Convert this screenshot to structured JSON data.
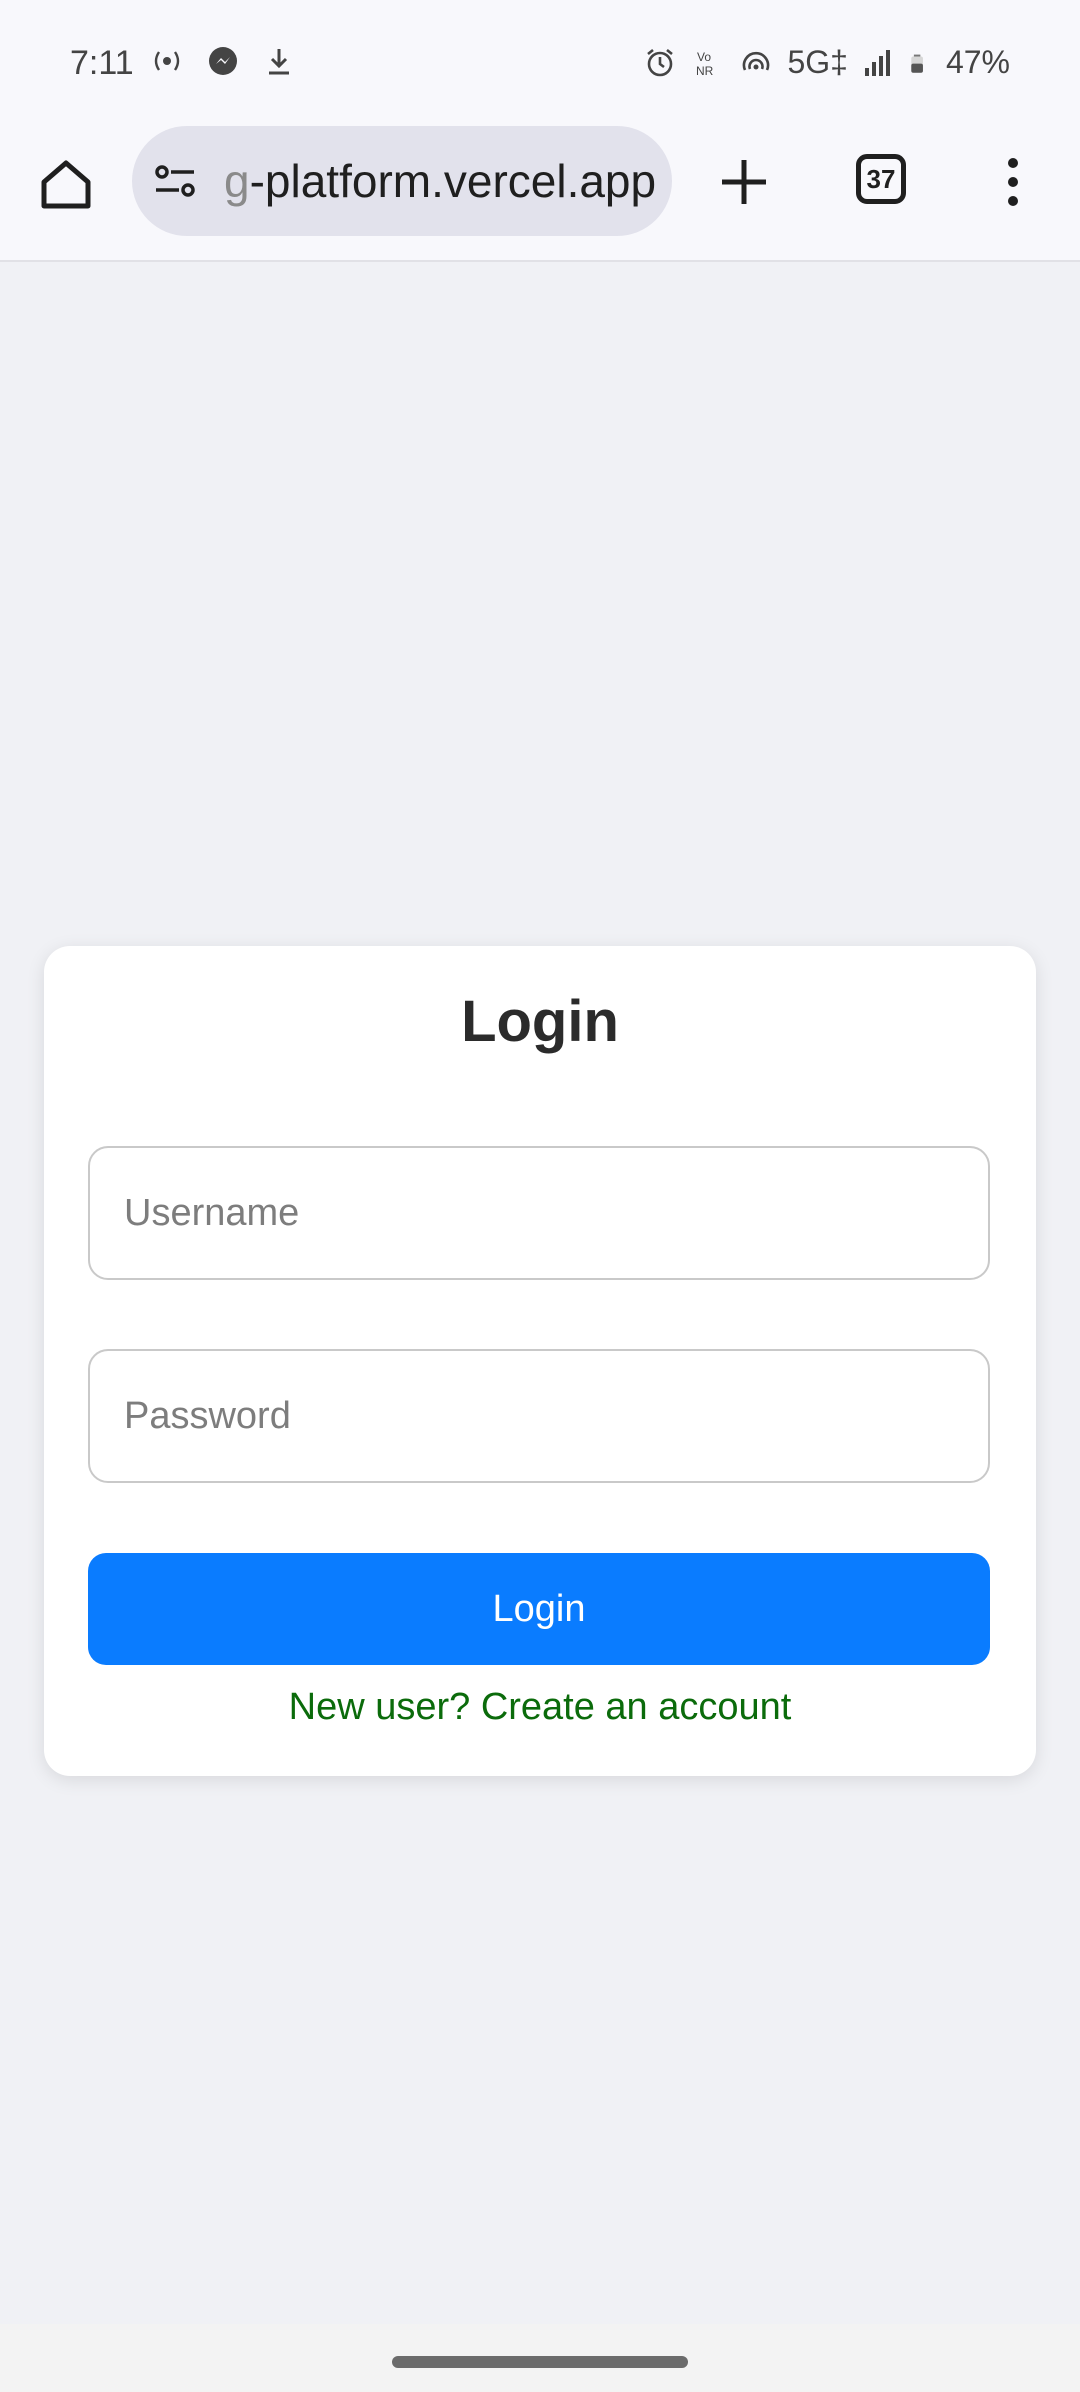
{
  "status_bar": {
    "time": "7:11",
    "left_icons": [
      "hotspot-icon",
      "messenger-icon",
      "download-icon"
    ],
    "right_icons": [
      "alarm-icon",
      "vonr-icon",
      "wireless-icon",
      "5g-icon",
      "signal-icon",
      "battery-icon"
    ],
    "network": "5G‡",
    "battery": "47%"
  },
  "browser": {
    "url_faded": "g",
    "url": "-platform.vercel.app",
    "tab_count": "37",
    "icons": [
      "home-icon",
      "tune-icon",
      "plus-icon",
      "tabs-icon",
      "more-vert-icon"
    ]
  },
  "login": {
    "title": "Login",
    "username_placeholder": "Username",
    "password_placeholder": "Password",
    "submit_label": "Login",
    "signup_link": "New user? Create an account"
  },
  "colors": {
    "page_bg": "#f0f1f5",
    "primary": "#0a7cff",
    "link": "#0b6b0b"
  }
}
